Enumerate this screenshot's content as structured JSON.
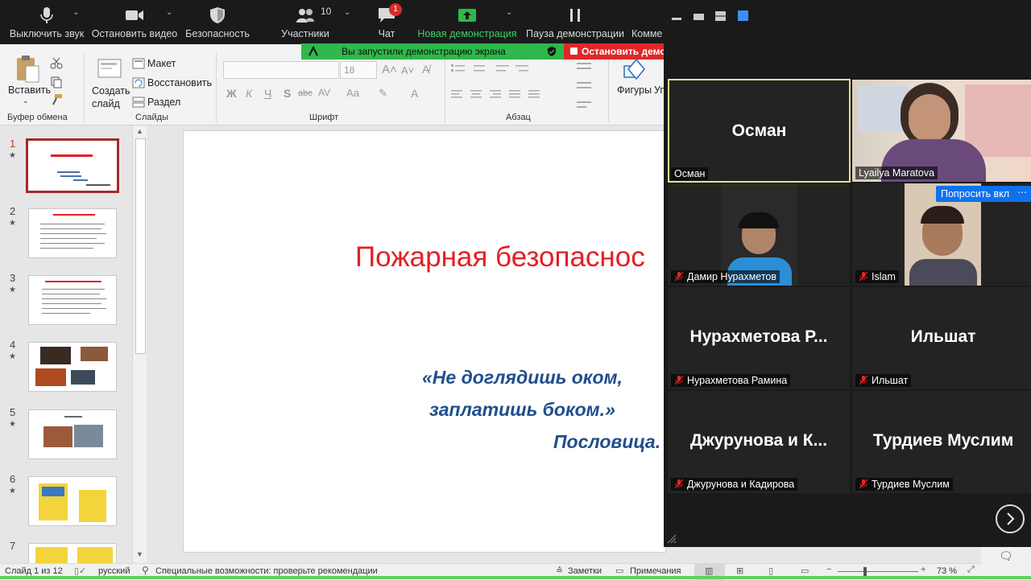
{
  "zoom_toolbar": {
    "mute": "Выключить звук",
    "stop_video": "Остановить видео",
    "security": "Безопасность",
    "participants": "Участники",
    "participants_count": "10",
    "chat": "Чат",
    "chat_badge": "1",
    "new_share": "Новая демонстрация",
    "pause_share": "Пауза демонстрации",
    "more": "Комме"
  },
  "share_banner": {
    "text": "Вы запустили демонстрацию экрана",
    "stop": "Остановить демо"
  },
  "ribbon": {
    "clipboard": {
      "paste": "Вставить",
      "group": "Буфер обмена"
    },
    "slides": {
      "new_slide_1": "Создать",
      "new_slide_2": "слайд",
      "layout": "Макет",
      "reset": "Восстановить",
      "section": "Раздел",
      "group": "Слайды"
    },
    "font": {
      "size": "18",
      "group": "Шрифт",
      "bold": "Ж",
      "italic": "К",
      "underline": "Ч",
      "shadow": "S",
      "strike": "abc",
      "spacing": "AV",
      "case": "Аа"
    },
    "paragraph": {
      "group": "Абзац"
    },
    "drawing": {
      "shapes": "Фигуры",
      "arrange": "Уп"
    }
  },
  "thumbnails": [
    {
      "num": "1"
    },
    {
      "num": "2"
    },
    {
      "num": "3"
    },
    {
      "num": "4"
    },
    {
      "num": "5"
    },
    {
      "num": "6"
    },
    {
      "num": "7"
    }
  ],
  "slide": {
    "title": "Пожарная безопаснос",
    "quote_line1": "«Не доглядишь оком,",
    "quote_line2": "заплатишь боком.»",
    "source": "Пословица."
  },
  "statusbar": {
    "slide_of": "Слайд 1 из 12",
    "language": "русский",
    "accessibility": "Специальные возможности: проверьте рекомендации",
    "notes": "Заметки",
    "comments": "Примечания",
    "zoom": "73 %"
  },
  "video_panel": {
    "ask_unmute": "Попросить вкл",
    "tiles": [
      {
        "big": "Осман",
        "label": "Осман"
      },
      {
        "big": "",
        "label": "Lyailya Maratova"
      },
      {
        "big": "",
        "label": "Дамир Нурахметов"
      },
      {
        "big": "",
        "label": "Islam"
      },
      {
        "big": "Нурахметова Р...",
        "label": "Нурахметова Рамина"
      },
      {
        "big": "Ильшат",
        "label": "Ильшат"
      },
      {
        "big": "Джурунова и К...",
        "label": "Джурунова и Кадирова"
      },
      {
        "big": "Турдиев Муслим",
        "label": "Турдиев Муслим"
      }
    ]
  },
  "colors": {
    "active_speaker": "#e8e08a",
    "share_green": "#2eb84b",
    "stop_red": "#e02828",
    "slide_title": "#e41e26",
    "quote": "#1f4e8c",
    "zoom_accent": "#0e72ed"
  }
}
